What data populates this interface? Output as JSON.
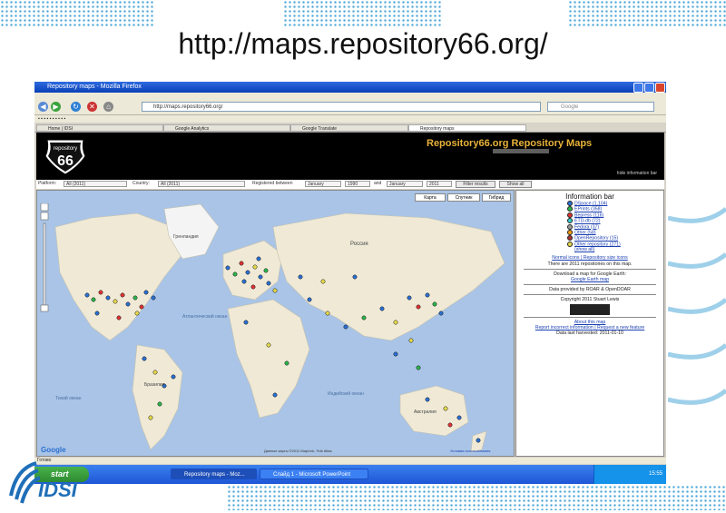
{
  "slide": {
    "title": "http://maps.repository66.org/",
    "logo_text": "IDSI"
  },
  "browser": {
    "window_title": "Repository maps - Mozilla Firefox",
    "url": "http://maps.repository66.org/",
    "search_placeholder": "Google",
    "tabs": [
      "Home | IDSI",
      "Google Analytics",
      "Google Translate",
      "Repository maps"
    ],
    "active_tab_index": 3,
    "status": "Готово"
  },
  "page": {
    "banner_logo": "repository 66",
    "banner_title": "Repository66.org Repository Maps",
    "hide_info_bar": "hide information bar",
    "filter": {
      "platform_label": "Platform:",
      "platform_value": "All (2011)",
      "country_label": "Country:",
      "country_value": "All (2011)",
      "registered_label": "Registered between",
      "from_month": "January",
      "from_year": "1990",
      "and_label": "and",
      "to_month": "January",
      "to_year": "2011",
      "filter_button": "Filter results",
      "show_all_button": "Show all"
    },
    "map": {
      "type_buttons": [
        "Карта",
        "Спутник",
        "Гибрид"
      ],
      "labels": {
        "greenland": "Гренландия",
        "russia": "Россия",
        "atlantic": "Атлантический океан",
        "pacific": "Тихий океан",
        "indian": "Индийский океан",
        "brazil": "Бразилия",
        "australia": "Австралия"
      },
      "attribution": "Данные карты ©2011 MapLink, Tele Atlas",
      "terms": "Условия использования",
      "google": "Google"
    },
    "info_bar": {
      "heading": "Information bar",
      "legend": [
        {
          "label": "DSpace (1,104)",
          "color": "#2b6fd1"
        },
        {
          "label": "EPrints (358)",
          "color": "#2bb34a"
        },
        {
          "label": "Bepress (116)",
          "color": "#d33"
        },
        {
          "label": "ETD-db (72)",
          "color": "#3cc"
        },
        {
          "label": "Fedora (37)",
          "color": "#999"
        },
        {
          "label": "Other (58)",
          "color": "#f39c12"
        },
        {
          "label": "OpenRepository (15)",
          "color": "#a33"
        },
        {
          "label": "Other repository (271)",
          "color": "#e5d94a"
        },
        {
          "label": "(show all)",
          "color": ""
        }
      ],
      "icons_link": "Normal icons | Repository size icons",
      "count_text": "There are 2011 repositories on this map.",
      "download_text": "Download a map for Google Earth:",
      "earth_link": "Google Earth map",
      "data_text": "Data provided by ROAR & OpenDOAR",
      "copyright": "Copyright 2011 Stuart Lewis",
      "about": "About this map",
      "feedback": "Report incorrect information | Request a new feature",
      "updated": "Data last harvested: 2011-01-10"
    }
  },
  "taskbar": {
    "start": "start",
    "tasks": [
      "Repository maps - Moz...",
      "Слайд 1 - Microsoft PowerPoint"
    ],
    "clock": "15:55"
  },
  "colors": {
    "banner_title": "#e8b23a",
    "dot_fill": "#4aa6d8",
    "logo": "#1f6fb8"
  }
}
